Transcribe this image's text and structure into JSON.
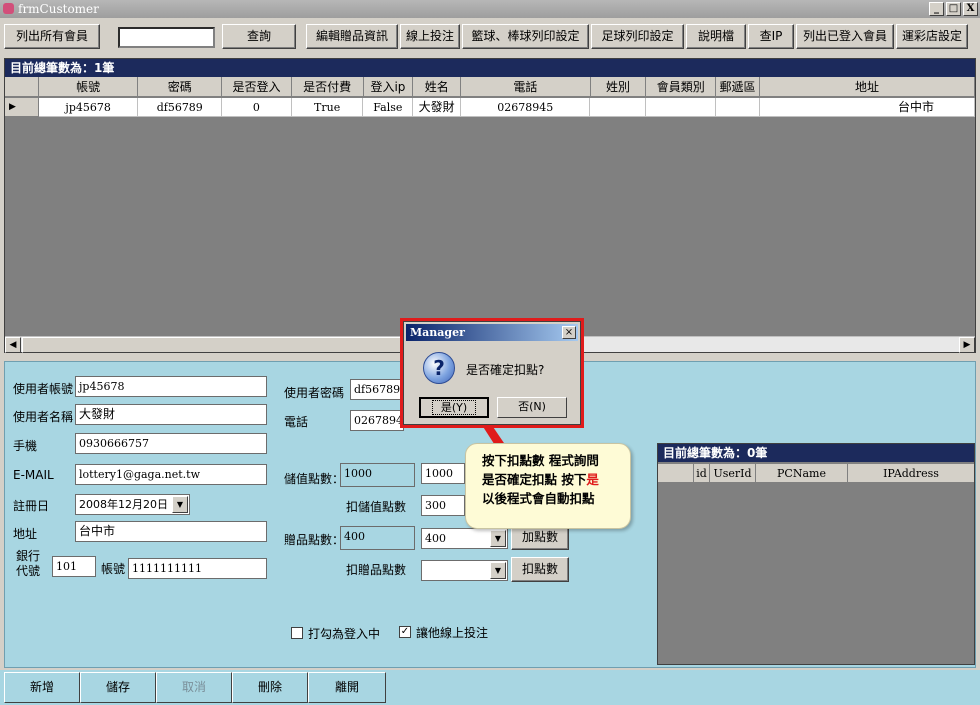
{
  "window": {
    "title": "frmCustomer",
    "min": "_",
    "max": "ð",
    "close": "X"
  },
  "toolbar": {
    "list_all": "列出所有會員",
    "search_value": "",
    "query": "查詢",
    "edit_gift": "編輯贈品資訊",
    "online_bet": "線上投注",
    "basket_print": "籃球、棒球列印設定",
    "soccer_print": "足球列印設定",
    "manual": "說明檔",
    "check_ip": "查IP",
    "list_logged": "列出已登入會員",
    "lottery_store": "運彩店設定"
  },
  "grid": {
    "header": "目前總筆數為：1筆",
    "columns": [
      "帳號",
      "密碼",
      "是否登入",
      "是否付費",
      "登入ip",
      "姓名",
      "電話",
      "姓別",
      "會員類別",
      "郵遞區",
      "地址"
    ],
    "row": {
      "indicator": "▶",
      "cells": [
        "jp45678",
        "df56789",
        "0",
        "True",
        "False",
        "大發財",
        "02678945",
        "",
        "",
        "",
        "台中市"
      ]
    },
    "scroll_left": "◀",
    "scroll_right": "▶"
  },
  "form": {
    "account_label": "使用者帳號",
    "account_value": "jp45678",
    "name_label": "使用者名稱",
    "name_value": "大發財",
    "mobile_label": "手機",
    "mobile_value": "0930666757",
    "email_label": "E-MAIL",
    "email_value": "lottery1@gaga.net.tw",
    "regdate_label": "註冊日",
    "regdate_value": "2008年12月20日",
    "address_label": "地址",
    "address_value": "台中市",
    "bank_label_1": "銀行",
    "bank_label_2": "代號",
    "bank_code": "101",
    "bank_account_label": "帳號",
    "bank_account": "1111111111",
    "password_label": "使用者密碼",
    "password_value": "df56789",
    "phone_label": "電話",
    "phone_value": "02678945",
    "stored_label": "儲值點數：",
    "stored_value": "1000",
    "stored_input": "1000",
    "deduct_stored_label": "扣儲值點數",
    "deduct_stored_value": "300",
    "gift_label": "贈品點數：",
    "gift_value": "400",
    "gift_select": "400",
    "add_points": "加點數",
    "deduct_gift_label": "扣贈品點數",
    "deduct_gift_select": "",
    "deduct_points": "扣點數",
    "mark_login": "打勾為登入中",
    "mark_login_checked": false,
    "allow_online": "讓他線上投注",
    "allow_online_checked": true
  },
  "subgrid": {
    "header": "目前總筆數為：0筆",
    "columns": [
      "id",
      "UserId",
      "PCName",
      "IPAddress"
    ]
  },
  "bottom": {
    "add": "新增",
    "save": "儲存",
    "cancel": "取消",
    "delete": "刪除",
    "leave": "離開"
  },
  "dialog": {
    "title": "Manager",
    "close": "×",
    "icon": "?",
    "message": "是否確定扣點?",
    "yes": "是(Y)",
    "no": "否(N)"
  },
  "callout": {
    "line1": "按下扣點數 程式詢問",
    "line2a": "是否確定扣點 按下",
    "line2b": "是",
    "line3": "以後程式會自動扣點"
  },
  "colors": {
    "accent_red": "#e01b1b",
    "panel": "#a8d6e2",
    "grid_header": "#1c2a5c"
  }
}
